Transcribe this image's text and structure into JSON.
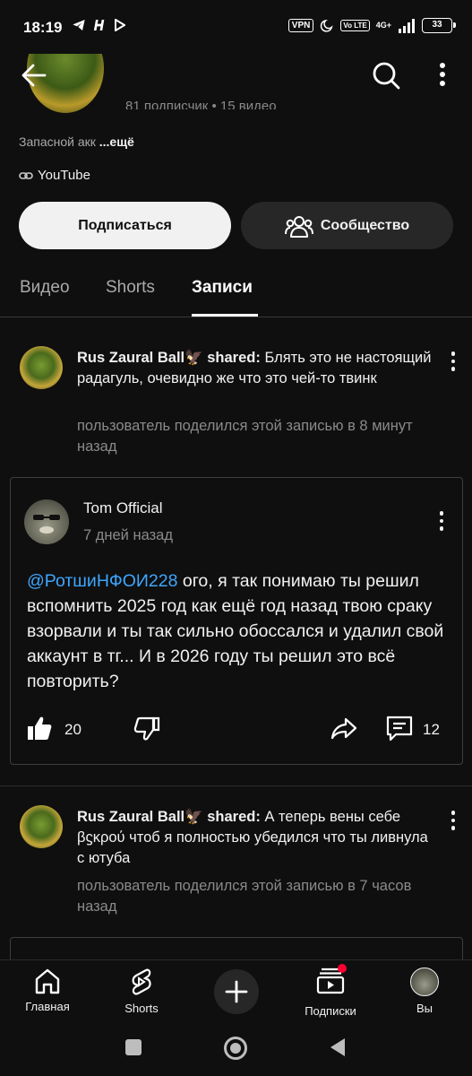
{
  "status_bar": {
    "time": "18:19",
    "vpn": "VPN",
    "volte": "Vo LTE",
    "network": "4G+",
    "battery": "33"
  },
  "channel": {
    "subscribers_line": "81 подписчик • 15 видео",
    "description": "Запасной акк",
    "more": "...ещё",
    "link": "YouTube",
    "subscribe_label": "Подписаться",
    "community_label": "Сообщество"
  },
  "tabs": [
    {
      "label": "Видео"
    },
    {
      "label": "Shorts"
    },
    {
      "label": "Записи"
    }
  ],
  "posts": [
    {
      "author": "Rus Zaural Ball🦅 shared:",
      "text": "Блять это не настоящий радагуль, очевидно же что это чей-то твинк",
      "meta": "пользователь поделился этой записью в 8 минут назад",
      "quoted": {
        "author": "Tom Official",
        "date": "7 дней назад",
        "mention": "@РотшиНФОИ228",
        "body": " ого, я так понимаю ты решил вспомнить 2025 год как ещё год назад твою сраку взорвали и ты так сильно обоссался и удалил свой аккаунт в тг... И в 2026 году ты решил это всё повторить?",
        "likes": "20",
        "comments": "12"
      }
    },
    {
      "author": "Rus Zaural Ball🦅 shared:",
      "text": "А теперь вены себе βϛκρού чтоб я полностью убедился что ты ливнула с ютуба",
      "meta": "пользователь поделился этой записью в 7 часов назад"
    }
  ],
  "bottom_nav": [
    {
      "label": "Главная",
      "icon": "home-icon"
    },
    {
      "label": "Shorts",
      "icon": "shorts-icon"
    },
    {
      "label": "",
      "icon": "plus-icon"
    },
    {
      "label": "Подписки",
      "icon": "subscriptions-icon"
    },
    {
      "label": "Вы",
      "icon": "profile-avatar"
    }
  ],
  "colors": {
    "background": "#0f0f0f",
    "accent_link": "#3ea6ff",
    "notification": "#ff0033"
  }
}
